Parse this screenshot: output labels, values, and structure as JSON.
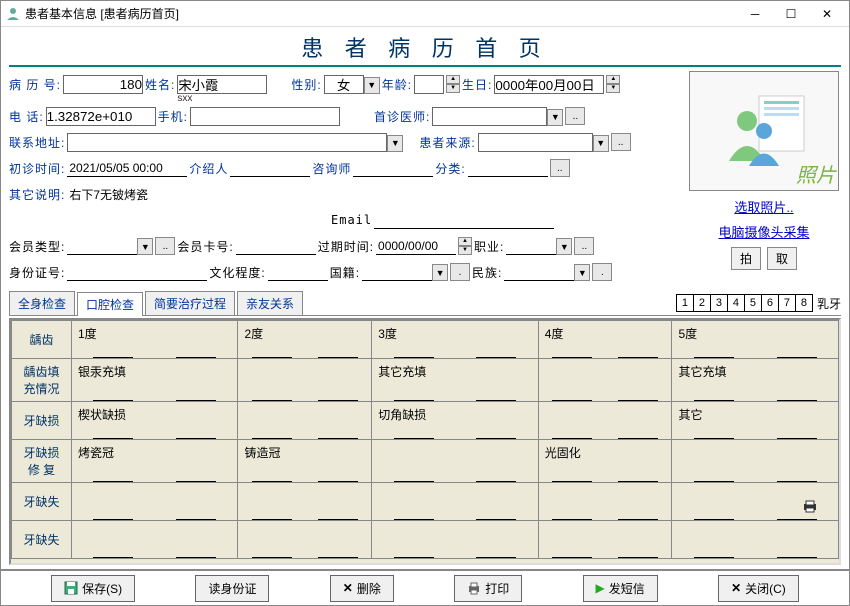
{
  "window": {
    "title": "患者基本信息    [患者病历首页]"
  },
  "header": {
    "title": "患 者 病 历 首 页"
  },
  "form": {
    "record_no_label": "病 历 号:",
    "record_no": "180",
    "name_label": "姓名:",
    "name": "宋小霞",
    "name_pinyin": "sxx",
    "gender_label": "性别:",
    "gender": "女",
    "age_label": "年龄:",
    "age": "",
    "birth_label": "生日:",
    "birth": "0000年00月00日",
    "phone_label": "电       话:",
    "phone": "1.32872e+010",
    "mobile_label": "手机:",
    "mobile": "",
    "first_doctor_label": "首诊医师:",
    "first_doctor": "",
    "addr_label": "联系地址:",
    "addr": "",
    "source_label": "患者来源:",
    "source": "",
    "first_time_label": "初诊时间:",
    "first_time": "2021/05/05 00:00",
    "referrer_label": "介绍人",
    "referrer": "",
    "consultant_label": "咨询师",
    "consultant": "",
    "category_label": "分类:",
    "category": "",
    "other_label": "其它说明:",
    "other": "右下7无铍烤瓷",
    "email_label": "Email",
    "email": "",
    "member_type_label": "会员类型:",
    "member_type": "",
    "member_card_label": "会员卡号:",
    "member_card": "",
    "expire_label": "过期时间:",
    "expire": "0000/00/00",
    "occupation_label": "职业:",
    "occupation": "",
    "idcard_label": "身份证号:",
    "idcard": "",
    "education_label": "文化程度:",
    "education": "",
    "nationality_label": "国籍:",
    "nationality": "",
    "ethnicity_label": "民族:",
    "ethnicity": ""
  },
  "photo": {
    "label": "照片",
    "select_btn": "选取照片..",
    "camera_btn": "电脑摄像头采集",
    "pai": "拍",
    "qu": "取"
  },
  "tabs": {
    "items": [
      "全身检查",
      "口腔检查",
      "简要治疗过程",
      "亲友关系"
    ],
    "active": 1,
    "numbers": [
      "1",
      "2",
      "3",
      "4",
      "5",
      "6",
      "7",
      "8"
    ],
    "milk": "乳牙"
  },
  "grid": {
    "rows": [
      {
        "head": "龋齿",
        "cells": [
          "1度",
          "2度",
          "3度",
          "4度",
          "5度"
        ]
      },
      {
        "head": "龋齿填充情况",
        "cells": [
          "银汞充填",
          "",
          "其它充填",
          "",
          "其它充填"
        ]
      },
      {
        "head": "牙缺损",
        "cells": [
          "楔状缺损",
          "",
          "切角缺损",
          "",
          "其它"
        ]
      },
      {
        "head": "牙缺损修 复",
        "cells": [
          "烤瓷冠",
          "铸造冠",
          "",
          "光固化",
          ""
        ]
      },
      {
        "head": "牙缺失",
        "cells": [
          "",
          "",
          "",
          "",
          ""
        ]
      },
      {
        "head": "牙缺失",
        "cells": [
          "",
          "",
          "",
          "",
          ""
        ]
      }
    ]
  },
  "bottom": {
    "save": "保存(S)",
    "read_id": "读身份证",
    "delete": "删除",
    "print": "打印",
    "sms": "发短信",
    "close": "关闭(C)"
  }
}
